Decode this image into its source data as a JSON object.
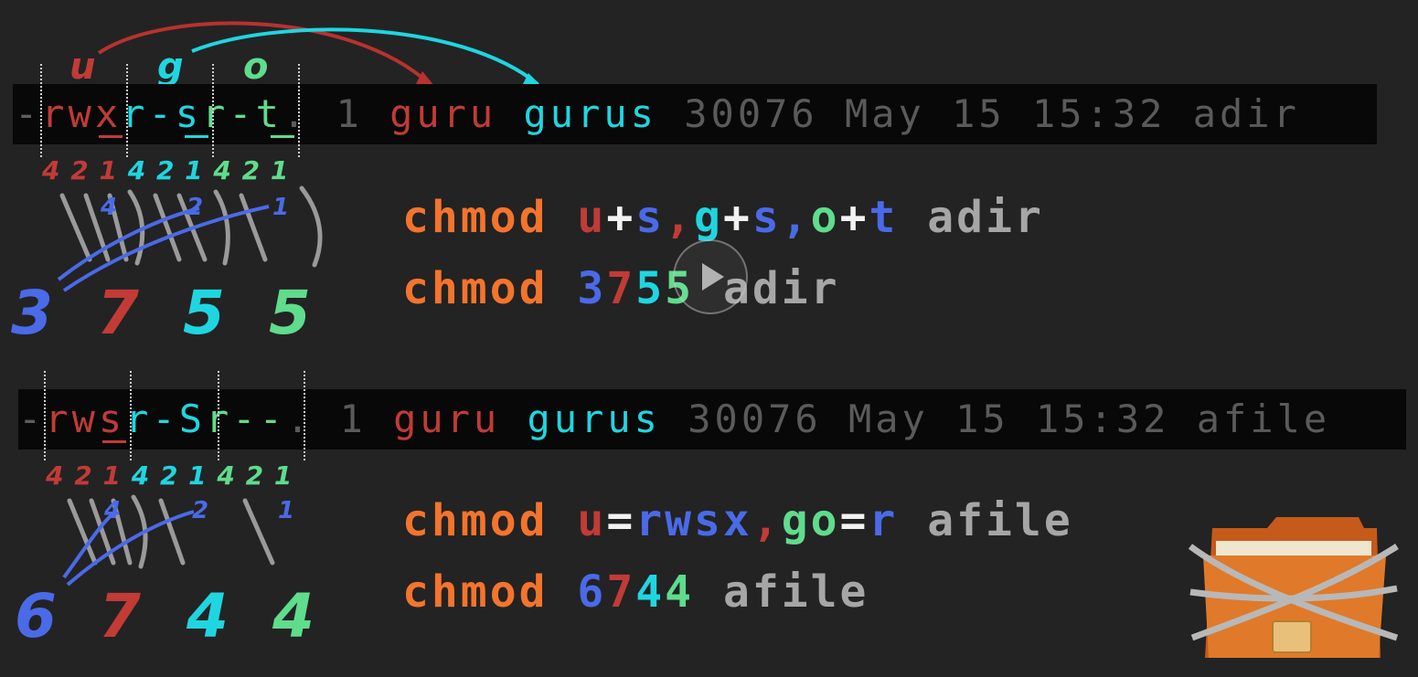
{
  "labels": {
    "u": "u",
    "g": "g",
    "o": "o"
  },
  "row1": {
    "lead": "-",
    "user_perm": "rwx",
    "group_perm": "r-s",
    "other_perm": "r-t",
    "dot": ".",
    "links": "1",
    "owner": "guru",
    "group": "gurus",
    "size": "30076",
    "month": "May",
    "day": "15",
    "time": "15:32",
    "name": "adir"
  },
  "row2": {
    "lead": "-",
    "user_perm": "rws",
    "group_perm": "r-S",
    "other_perm": "r--",
    "dot": ".",
    "links": "1",
    "owner": "guru",
    "group": "gurus",
    "size": "30076",
    "month": "May",
    "day": "15",
    "time": "15:32",
    "name": "afile"
  },
  "weights": {
    "four": "4",
    "two": "2",
    "one": "1"
  },
  "special_weights": {
    "four": "4",
    "two": "2",
    "one": "1"
  },
  "octal1": {
    "special": "3",
    "user": "7",
    "group": "5",
    "other": "5"
  },
  "octal2": {
    "special": "6",
    "user": "7",
    "group": "4",
    "other": "4"
  },
  "cmd1": {
    "word": "chmod",
    "u": "u",
    "plus1": "+",
    "s1": "s",
    "c1": ",",
    "g": "g",
    "plus2": "+",
    "s2": "s",
    "c2": ",",
    "o": "o",
    "plus3": "+",
    "t": "t",
    "target": "adir"
  },
  "cmd2": {
    "word": "chmod",
    "d1": "3",
    "d2": "7",
    "d3": "5",
    "d4": "5",
    "target": "adir"
  },
  "cmd3": {
    "word": "chmod",
    "u": "u",
    "eq1": "=",
    "perms": "rwsx",
    "c1": ",",
    "go": "go",
    "eq2": "=",
    "r": "r",
    "target": "afile"
  },
  "cmd4": {
    "word": "chmod",
    "d1": "6",
    "d2": "7",
    "d3": "4",
    "d4": "4",
    "target": "afile"
  },
  "colors": {
    "user": "#c23b36",
    "group": "#1fd6e0",
    "other": "#5fdc8c",
    "special": "#4a6ae8",
    "command": "#f4742c",
    "filename": "#a6a6a6",
    "meta": "#5a5a5a"
  },
  "icons": {
    "folder": "locked-folder-icon",
    "play": "play-icon"
  }
}
